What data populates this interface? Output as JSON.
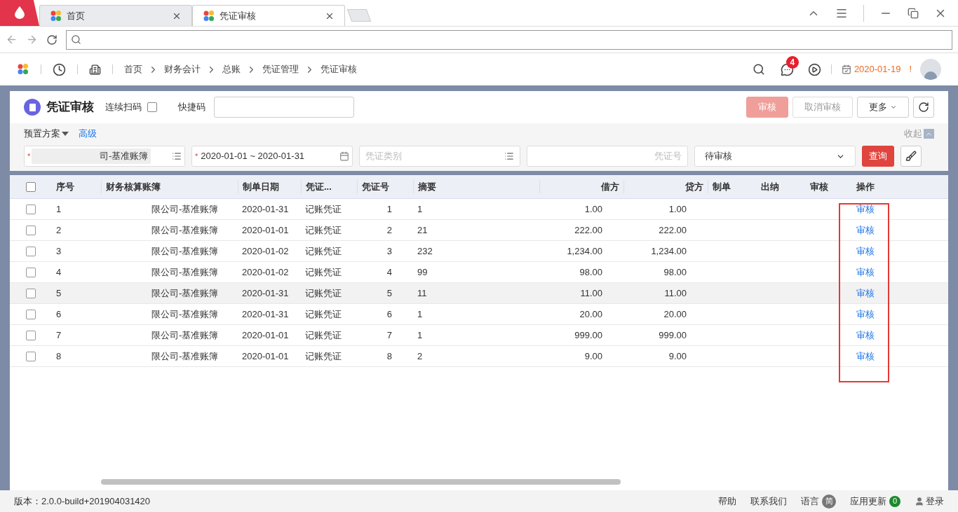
{
  "browser": {
    "tabs": [
      {
        "label": "首页",
        "selected": false
      },
      {
        "label": "凭证审核",
        "selected": true
      }
    ]
  },
  "header": {
    "breadcrumb": [
      "首页",
      "财务会计",
      "总账",
      "凭证管理",
      "凭证审核"
    ],
    "message_count": "4",
    "date": "2020-01-19",
    "alert": "!"
  },
  "toolbar": {
    "title": "凭证审核",
    "scan_label": "连续扫码",
    "scan_checked": false,
    "quick_code_label": "快捷码",
    "buttons": [
      {
        "label": "审核",
        "kind": "primary",
        "disabled": true
      },
      {
        "label": "取消审核",
        "kind": "default",
        "disabled": true
      },
      {
        "label": "更多",
        "kind": "menu",
        "disabled": false
      }
    ]
  },
  "filters": {
    "required_mark": "*",
    "scheme": "预置方案",
    "advanced": "高级",
    "collapse": "收起",
    "account_book": "司-基准账簿",
    "date_range": "2020-01-01 ~ 2020-01-31",
    "voucher_type_placeholder": "凭证类别",
    "voucher_no_placeholder": "凭证号",
    "status": "待审核",
    "search": "查询"
  },
  "table": {
    "select_all_checked": false,
    "columns": [
      "序号",
      "财务核算账簿",
      "制单日期",
      "凭证...",
      "凭证号",
      "摘要",
      "借方",
      "贷方",
      "制单",
      "出纳",
      "审核",
      "操作"
    ],
    "rows": [
      {
        "no": "1",
        "book": "限公司-基准账簿",
        "date": "2020-01-31",
        "type": "记账凭证",
        "voucher": "1",
        "summary": "1",
        "debit": "1.00",
        "credit": "1.00",
        "action": "审核",
        "hovered": false,
        "checked": false
      },
      {
        "no": "2",
        "book": "限公司-基准账簿",
        "date": "2020-01-01",
        "type": "记账凭证",
        "voucher": "2",
        "summary": "21",
        "debit": "222.00",
        "credit": "222.00",
        "action": "审核",
        "hovered": false,
        "checked": false
      },
      {
        "no": "3",
        "book": "限公司-基准账簿",
        "date": "2020-01-02",
        "type": "记账凭证",
        "voucher": "3",
        "summary": "232",
        "debit": "1,234.00",
        "credit": "1,234.00",
        "action": "审核",
        "hovered": false,
        "checked": false
      },
      {
        "no": "4",
        "book": "限公司-基准账簿",
        "date": "2020-01-02",
        "type": "记账凭证",
        "voucher": "4",
        "summary": "99",
        "debit": "98.00",
        "credit": "98.00",
        "action": "审核",
        "hovered": false,
        "checked": false
      },
      {
        "no": "5",
        "book": "限公司-基准账簿",
        "date": "2020-01-31",
        "type": "记账凭证",
        "voucher": "5",
        "summary": "11",
        "debit": "11.00",
        "credit": "11.00",
        "action": "审核",
        "hovered": true,
        "checked": false
      },
      {
        "no": "6",
        "book": "限公司-基准账簿",
        "date": "2020-01-31",
        "type": "记账凭证",
        "voucher": "6",
        "summary": "1",
        "debit": "20.00",
        "credit": "20.00",
        "action": "审核",
        "hovered": false,
        "checked": false
      },
      {
        "no": "7",
        "book": "限公司-基准账簿",
        "date": "2020-01-01",
        "type": "记账凭证",
        "voucher": "7",
        "summary": "1",
        "debit": "999.00",
        "credit": "999.00",
        "action": "审核",
        "hovered": false,
        "checked": false
      },
      {
        "no": "8",
        "book": "限公司-基准账簿",
        "date": "2020-01-01",
        "type": "记账凭证",
        "voucher": "8",
        "summary": "2",
        "debit": "9.00",
        "credit": "9.00",
        "action": "审核",
        "hovered": false,
        "checked": false
      }
    ]
  },
  "status_bar": {
    "version": "版本：2.0.0-build+201904031420",
    "links": [
      "帮助",
      "联系我们"
    ],
    "language": "语言",
    "language_badge": "简",
    "updates": "应用更新",
    "update_count": "0",
    "login": "登录"
  }
}
